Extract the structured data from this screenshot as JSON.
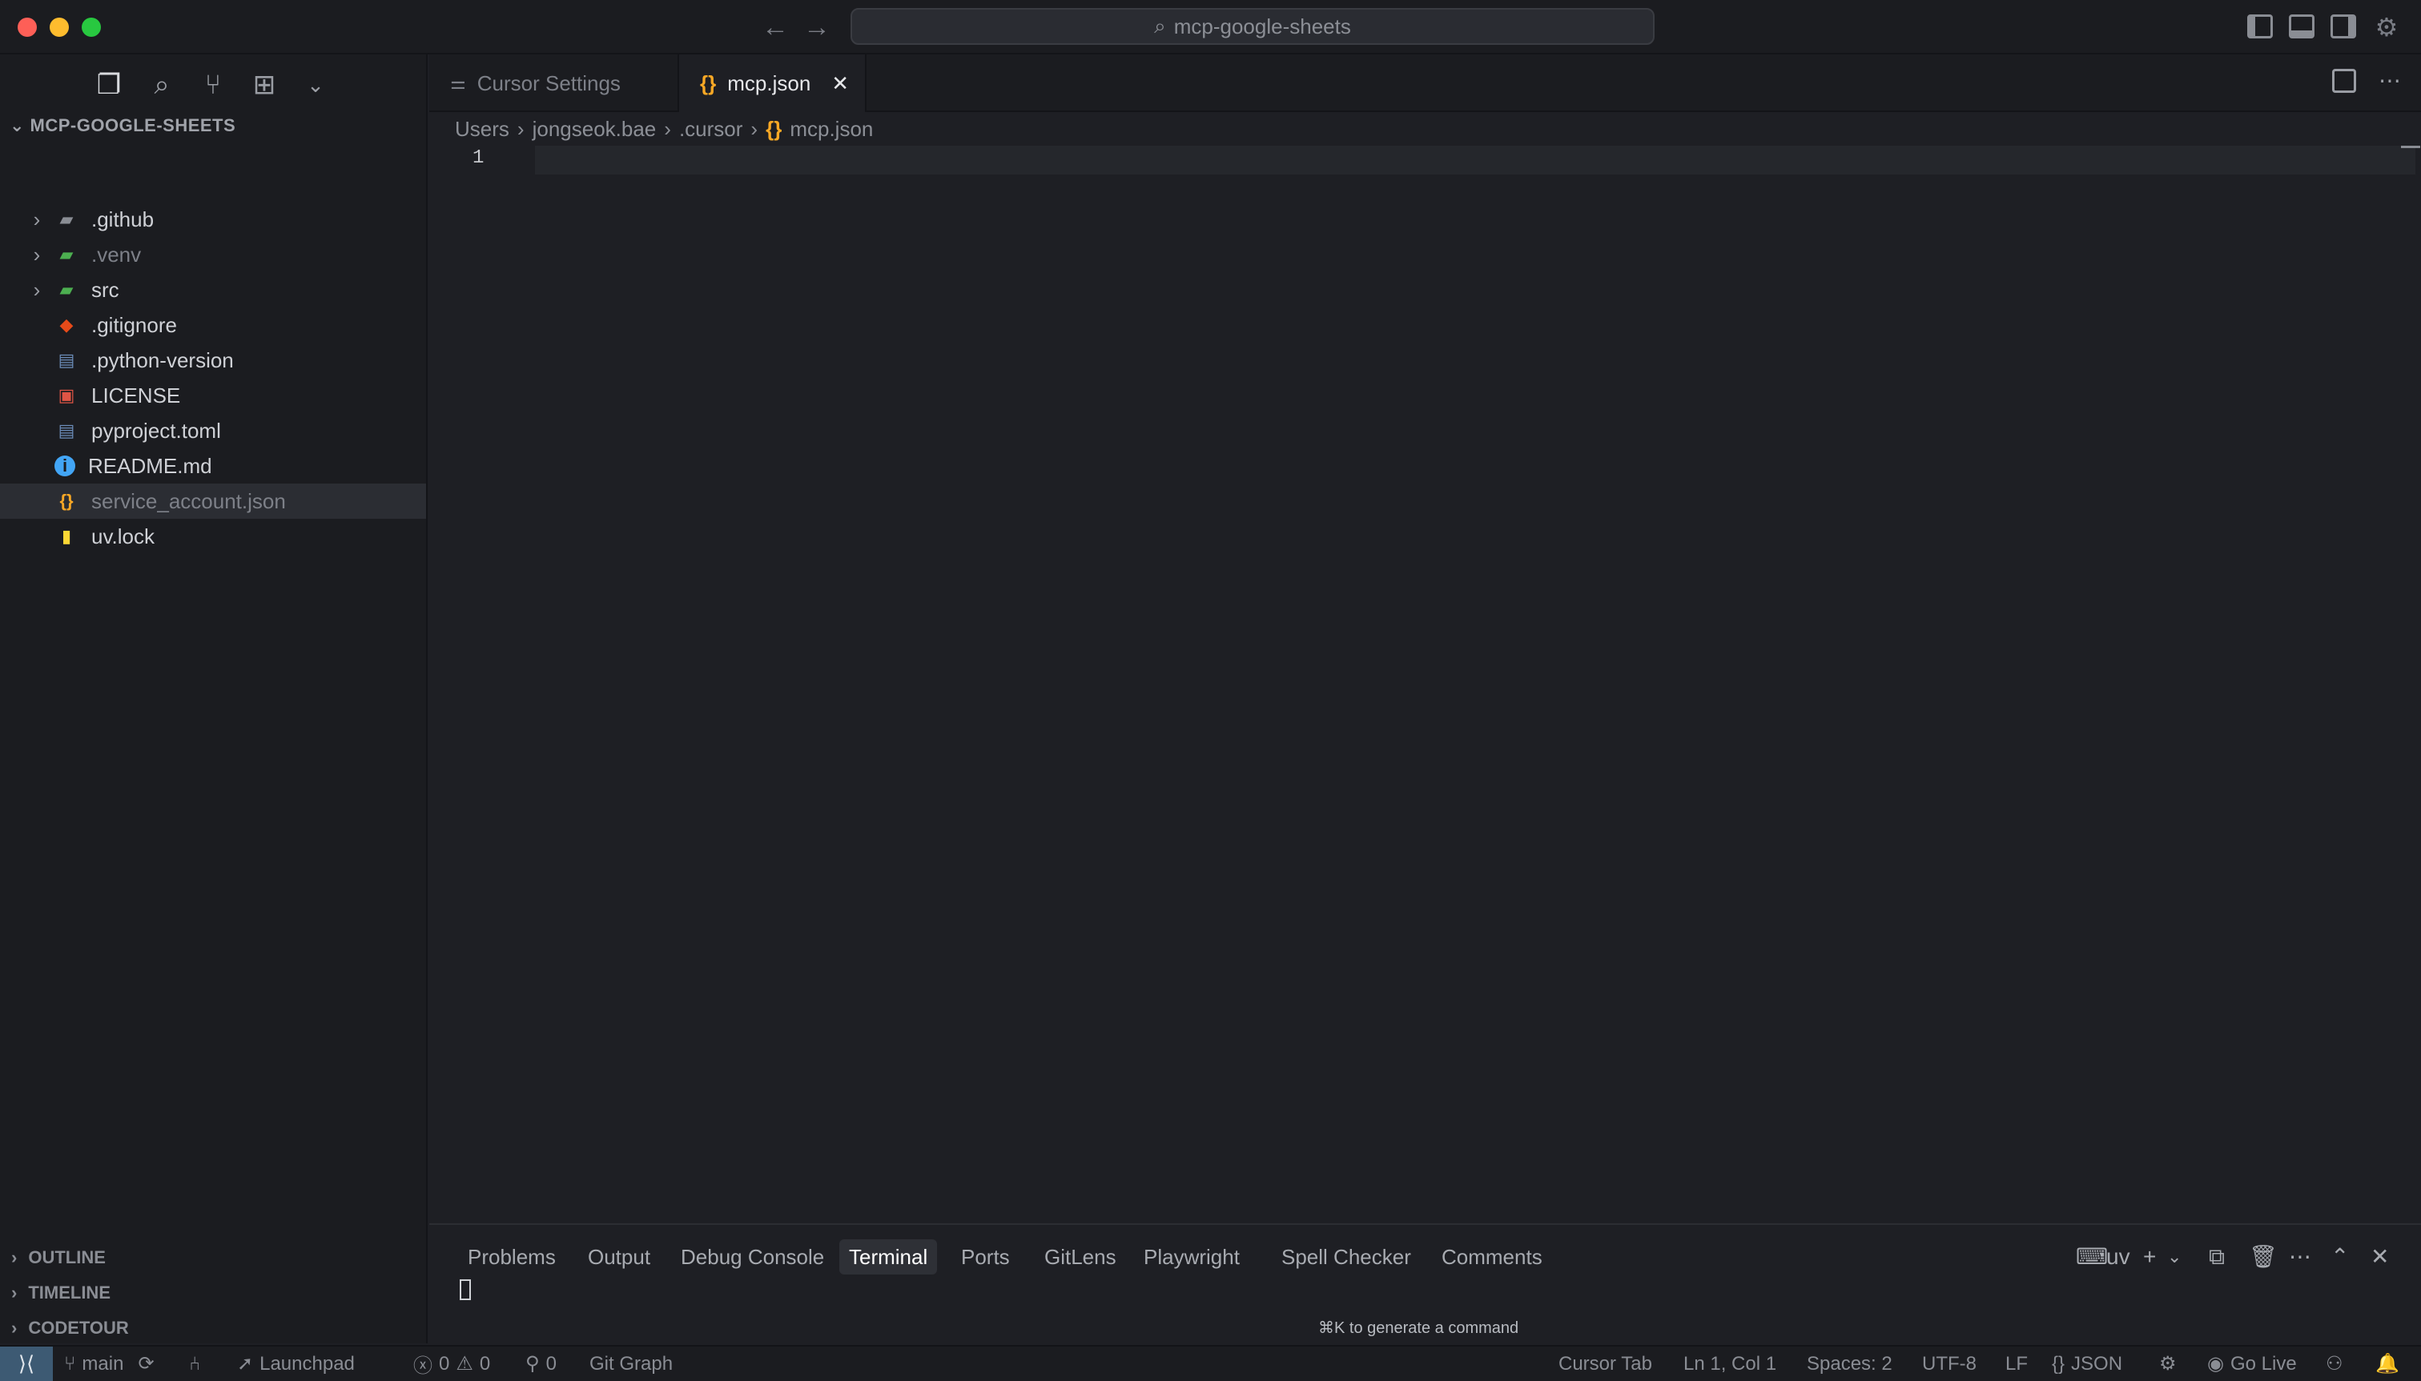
{
  "titlebar": {
    "search_text": "mcp-google-sheets"
  },
  "sidebar": {
    "explorer_title": "MCP-GOOGLE-SHEETS",
    "items": [
      {
        "label": ".github",
        "type": "folder",
        "icon": "github-folder-icon",
        "color": "#8a8d94"
      },
      {
        "label": ".venv",
        "type": "folder",
        "icon": "venv-folder-icon",
        "color": "#4caf50",
        "dim": true
      },
      {
        "label": "src",
        "type": "folder",
        "icon": "src-folder-icon",
        "color": "#4caf50"
      },
      {
        "label": ".gitignore",
        "type": "file",
        "icon": "git-icon",
        "color": "#e64a19"
      },
      {
        "label": ".python-version",
        "type": "file",
        "icon": "python-config-icon",
        "color": "#6b8cb8"
      },
      {
        "label": "LICENSE",
        "type": "file",
        "icon": "license-icon",
        "color": "#e05545"
      },
      {
        "label": "pyproject.toml",
        "type": "file",
        "icon": "python-config-icon",
        "color": "#6b8cb8"
      },
      {
        "label": "README.md",
        "type": "file",
        "icon": "info-icon",
        "color": "#42a5f5"
      },
      {
        "label": "service_account.json",
        "type": "file",
        "icon": "json-icon",
        "color": "#f9a825",
        "selected": true,
        "dim": true
      },
      {
        "label": "uv.lock",
        "type": "file",
        "icon": "lock-icon",
        "color": "#fdd835"
      }
    ],
    "sections": {
      "outline": "OUTLINE",
      "timeline": "TIMELINE",
      "codetour": "CODETOUR"
    }
  },
  "editor": {
    "tabs": [
      {
        "label": "Cursor Settings",
        "active": false
      },
      {
        "label": "mcp.json",
        "active": true
      }
    ],
    "breadcrumb": [
      "Users",
      "jongseok.bae",
      ".cursor",
      "mcp.json"
    ],
    "line_number": "1"
  },
  "panel": {
    "tabs": [
      "Problems",
      "Output",
      "Debug Console",
      "Terminal",
      "Ports",
      "GitLens",
      "Playwright",
      "Spell Checker",
      "Comments"
    ],
    "active_tab": "Terminal",
    "terminal_name": "uv",
    "hint": "⌘K to generate a command"
  },
  "statusbar": {
    "branch": "main",
    "launchpad": "Launchpad",
    "errors": "0",
    "warnings": "0",
    "ports": "0",
    "git_graph": "Git Graph",
    "cursor_tab": "Cursor Tab",
    "position": "Ln 1, Col 1",
    "spaces": "Spaces: 2",
    "encoding": "UTF-8",
    "eol": "LF",
    "language": "JSON",
    "go_live": "Go Live"
  },
  "colors": {
    "json_icon": "#f9a825",
    "remote_bg": "#3d5a73",
    "tl_red": "#fe5f57",
    "tl_yellow": "#febc2e",
    "tl_green": "#28c840"
  }
}
